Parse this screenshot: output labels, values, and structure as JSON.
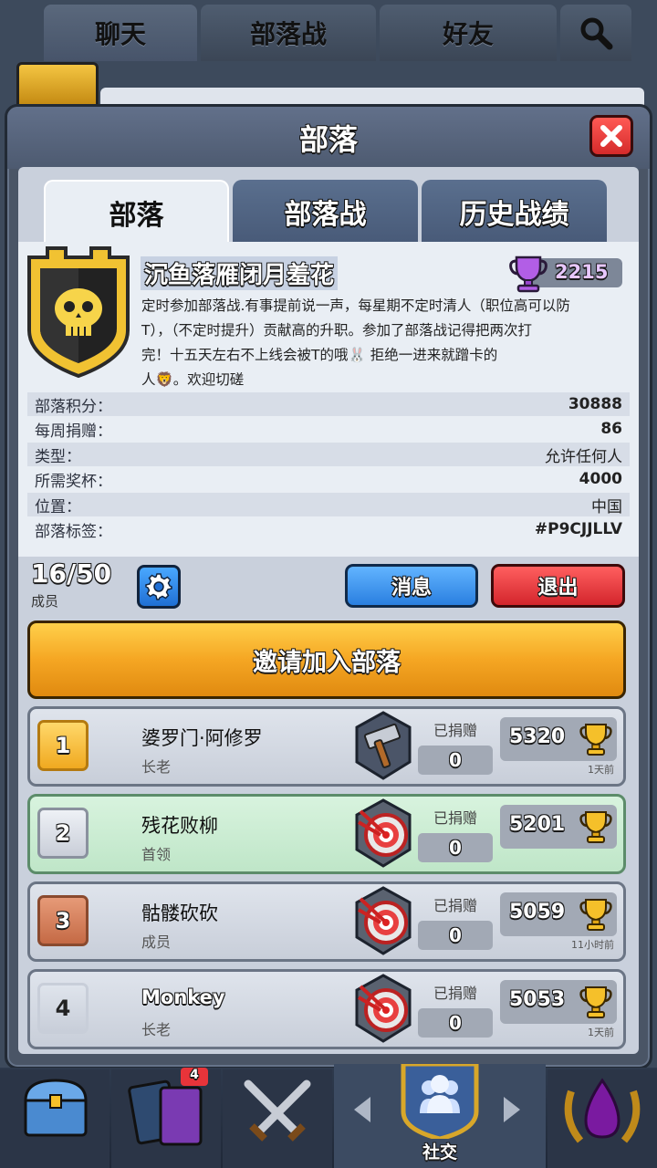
{
  "top_tabs": [
    "聊天",
    "部落战",
    "好友"
  ],
  "modal": {
    "title": "部落"
  },
  "sub_tabs": [
    "部落",
    "部落战",
    "历史战绩"
  ],
  "clan": {
    "name": "沉鱼落雁闭月羞花",
    "trophies": "2215",
    "description_lines": [
      "定时参加部落战.有事提前说一声，每星期不定时清人（职位高可以防",
      "T），（不定时提升）贡献高的升职。参加了部落战记得把两次打",
      "完！十五天左右不上线会被T的哦🐰                  拒绝一进来就蹭卡的",
      "人🦁。欢迎切磋"
    ]
  },
  "stats": [
    {
      "label": "部落积分：",
      "value": "30888"
    },
    {
      "label": "每周捐赠：",
      "value": "86"
    },
    {
      "label": "类型：",
      "value": "允许任何人"
    },
    {
      "label": "所需奖杯：",
      "value": "4000"
    },
    {
      "label": "位置：",
      "value": "中国"
    },
    {
      "label": "部落标签：",
      "value": "#P9CJJLLV"
    }
  ],
  "members_summary": {
    "count": "16/50",
    "label": "成员"
  },
  "buttons": {
    "message": "消息",
    "leave": "退出",
    "invite": "邀请加入部落"
  },
  "members": [
    {
      "rank": "1",
      "name": "婆罗门·阿修罗",
      "role": "长老",
      "donated_label": "已捐赠",
      "donated": "0",
      "trophies": "5320",
      "last_seen": "1天前",
      "icon": "hammer-icon"
    },
    {
      "rank": "2",
      "name": "残花败柳",
      "role": "首领",
      "donated_label": "已捐赠",
      "donated": "0",
      "trophies": "5201",
      "last_seen": "",
      "icon": "target-icon"
    },
    {
      "rank": "3",
      "name": "骷髅砍砍",
      "role": "成员",
      "donated_label": "已捐赠",
      "donated": "0",
      "trophies": "5059",
      "last_seen": "11小时前",
      "icon": "target-icon"
    },
    {
      "rank": "4",
      "name": "Monkey",
      "role": "长老",
      "donated_label": "已捐赠",
      "donated": "0",
      "trophies": "5053",
      "last_seen": "1天前",
      "icon": "target-icon"
    }
  ],
  "bottom_nav": {
    "active_label": "社交",
    "badge": "4"
  },
  "colors": {
    "accent_gold": "#f5a623",
    "message_blue": "#3a8ee6",
    "leave_red": "#e8343a"
  }
}
